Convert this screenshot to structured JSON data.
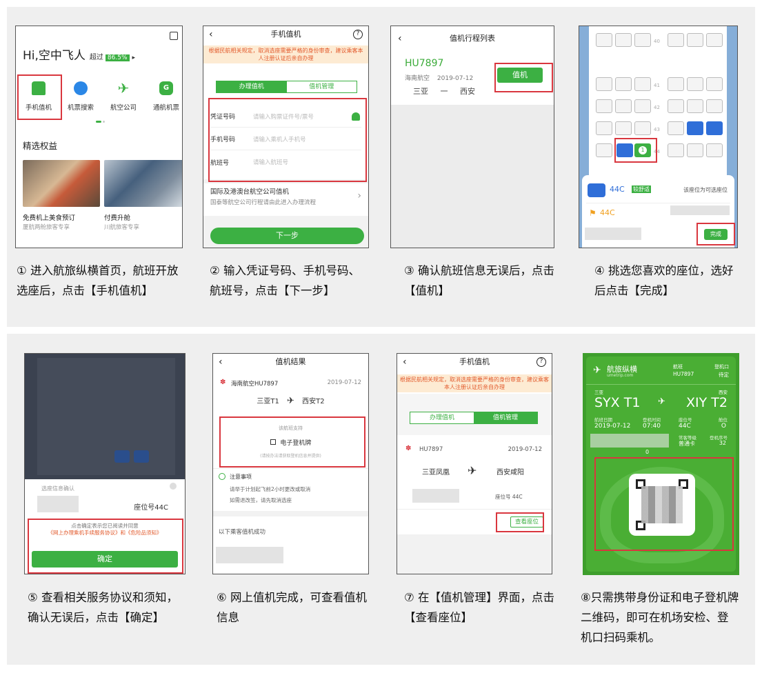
{
  "colors": {
    "brand_green": "#3cb043",
    "highlight_red": "#d9363e",
    "notice_orange": "#e25a2c",
    "seat_blue": "#2f6ed8"
  },
  "step1": {
    "greeting": "Hi,空中飞人",
    "beat_prefix": "超过",
    "beat_pct": "86.5%",
    "icons": [
      "手机值机",
      "机票搜索",
      "航空公司",
      "通航机票"
    ],
    "section_title": "精选权益",
    "cards": [
      {
        "title": "免费机上美食预订",
        "sub": "厦航两舱旅客专享"
      },
      {
        "title": "付费升舱",
        "sub": "川航旅客专享"
      }
    ],
    "caption": "① 进入航旅纵横首页，航班开放选座后，点击【手机值机】"
  },
  "step2": {
    "title": "手机值机",
    "notice": "根据民航相关规定，取消选座需要严格的身份审查，建议乘客本人注册认证后亲自办理",
    "tab_active": "办理值机",
    "tab_other": "值机管理",
    "fields": [
      {
        "label": "凭证号码",
        "placeholder": "请输入购票证件号/票号"
      },
      {
        "label": "手机号码",
        "placeholder": "请输入乘机人手机号"
      },
      {
        "label": "航班号",
        "placeholder": "请输入航班号"
      }
    ],
    "intl_title": "国际及港澳台航空公司值机",
    "intl_sub": "国泰等航空公司行程请由此进入办理流程",
    "next_button": "下一步",
    "caption": "② 输入凭证号码、手机号码、航班号，点击【下一步】"
  },
  "step3": {
    "title": "值机行程列表",
    "flight_no": "HU7897",
    "airline": "海南航空",
    "date": "2019-07-12",
    "from": "三亚",
    "dash": "一",
    "to": "西安",
    "checkin_button": "值机",
    "caption": "③ 确认航班信息无误后，点击【值机】"
  },
  "step4": {
    "rows": [
      "40",
      "41",
      "42",
      "43",
      "44"
    ],
    "selected_badge": "1",
    "seat_code": "44C",
    "tag": "较舒适",
    "available_text": "该座位为可选座位",
    "passenger_seat": "44C",
    "done_button": "完成",
    "caption": "④ 挑选您喜欢的座位，选好后点击【完成】"
  },
  "step5": {
    "dialog_title": "选座信息确认",
    "seat_label": "座位号44C",
    "agree_text": "点击确定表示您已阅读并同意",
    "agree_links": "《网上办理乘机手续服务协议》和《危险品须知》",
    "confirm_button": "确定",
    "caption": "⑤ 查看相关服务协议和须知，确认无误后，点击【确定】"
  },
  "step6": {
    "title": "值机结果",
    "airline_flight": "海南航空HU7897",
    "date": "2019-07-12",
    "from": "三亚T1",
    "to": "西安T2",
    "support_label": "该航班支持",
    "eboard": "电子登机牌",
    "eboard_note": "(请按办法请获取登机信息并提供)",
    "notice_title": "注意事项",
    "notice_lines": [
      "请举于计划起飞前2小时更改或取消",
      "如需退改签，请先取消选座"
    ],
    "success_label": "以下乘客值机成功",
    "caption": "⑥ 网上值机完成，可查看值机信息"
  },
  "step7": {
    "title": "手机值机",
    "notice": "根据民航相关规定，取消选座需要严格的身份审查，建议乘客本人注册认证后亲自办理",
    "tab_other": "办理值机",
    "tab_active": "值机管理",
    "flight_no": "HU7897",
    "date": "2019-07-12",
    "from": "三亚凤凰",
    "to": "西安咸阳",
    "seat": "座位号 44C",
    "view_seat_button": "查看座位",
    "caption": "⑦ 在【值机管理】界面，点击【查看座位】"
  },
  "step8": {
    "brand": "航旅纵横",
    "brand_sub": "umetrip.com",
    "flight_label": "航班",
    "flight_value": "HU7897",
    "gate_label": "登机口",
    "gate_value": "待定",
    "from_city": "三亚",
    "to_city": "西安",
    "from_code": "SYX T1",
    "to_code": "XIY T2",
    "labels": [
      "航班日期",
      "登机时间",
      "座位号",
      "舱位"
    ],
    "values": [
      "2019-07-12",
      "07:40",
      "44C",
      "O"
    ],
    "member_label": "常客等级",
    "member_value": "普通卡",
    "seq_label": "登机序号",
    "seq_value": "32",
    "zero": "0",
    "caption": "⑧只需携带身份证和电子登机牌二维码，即可在机场安检、登机口扫码乘机。"
  }
}
